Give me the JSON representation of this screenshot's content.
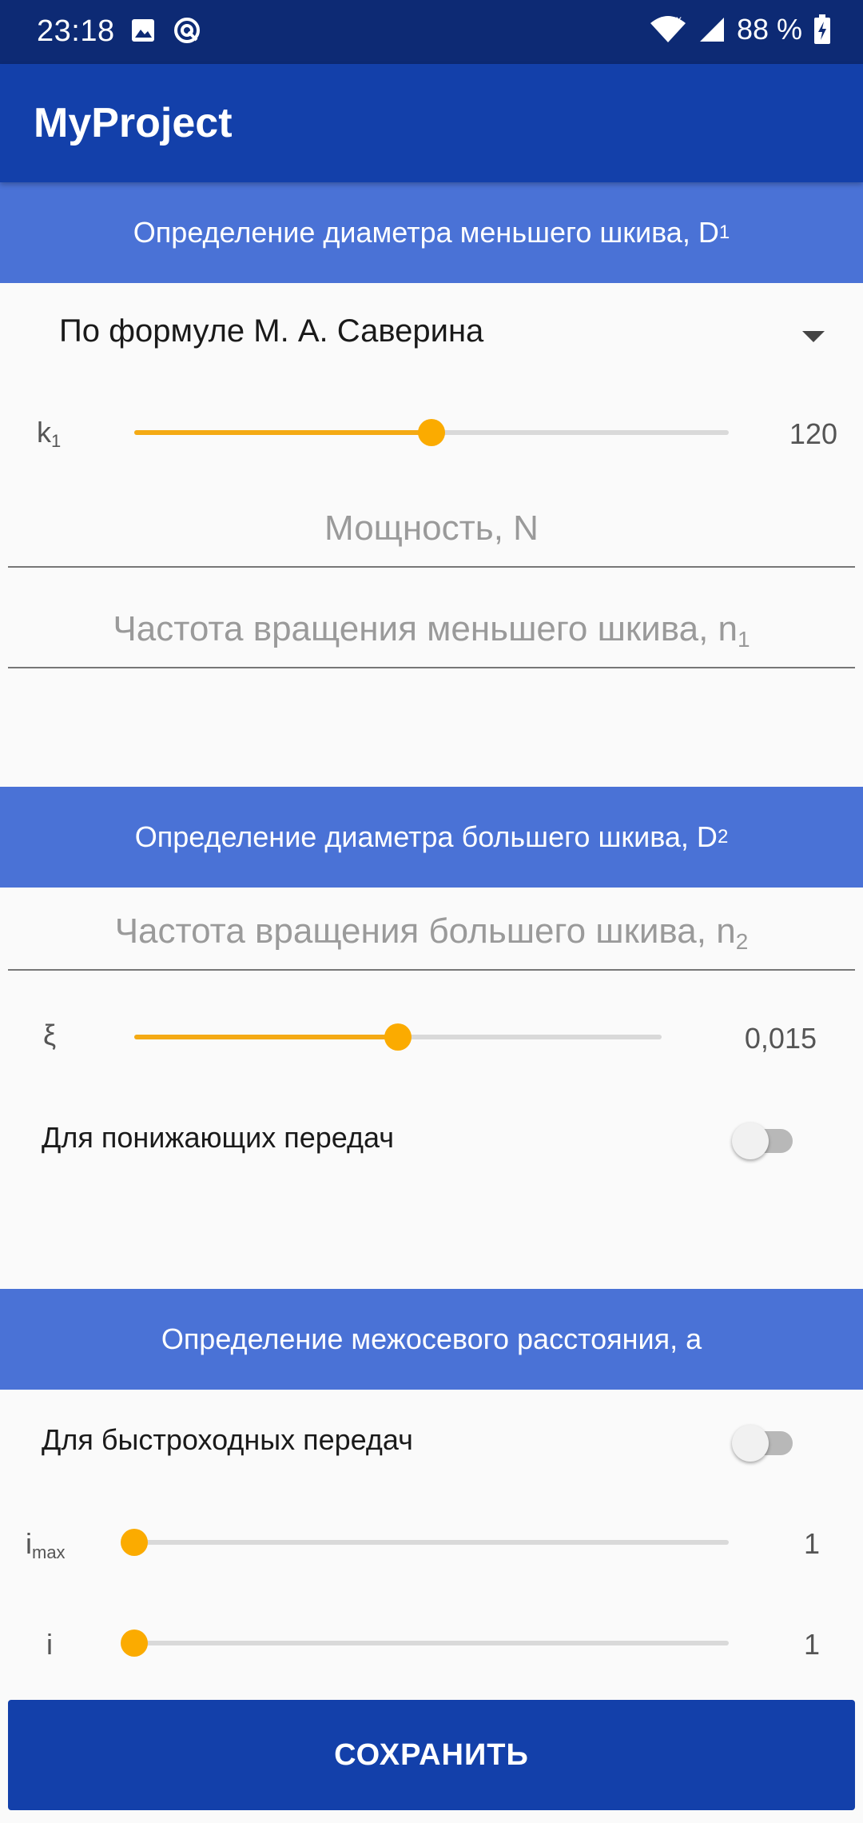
{
  "status_bar": {
    "time": "23:18",
    "battery": "88 %"
  },
  "app_bar": {
    "title": "MyProject"
  },
  "section1": {
    "header": "Определение диаметра меньшего шкива, D",
    "header_sub": "1",
    "method_dropdown": {
      "value": "По формуле М. А. Саверина"
    },
    "k1_slider": {
      "label": "k",
      "label_sub": "1",
      "value_text": "120",
      "level": 0.5
    },
    "power_input": {
      "placeholder": "Мощность, N"
    },
    "n1_input": {
      "placeholder": "Частота вращения меньшего шкива, n",
      "placeholder_sub": "1"
    }
  },
  "section2": {
    "header": "Определение диаметра большего шкива, D",
    "header_sub": "2",
    "n2_input": {
      "placeholder": "Частота вращения большего шкива, n",
      "placeholder_sub": "2"
    },
    "xi_slider": {
      "label": "ξ",
      "value_text": "0,015",
      "level": 0.5
    },
    "reduction_switch": {
      "label": "Для понижающих передач",
      "checked": false
    }
  },
  "section3": {
    "header": "Определение межосевого расстояния, a",
    "fast_switch": {
      "label": "Для быстроходных передач",
      "checked": false
    },
    "imax_slider": {
      "label": "i",
      "label_sub": "max",
      "value_text": "1",
      "level": 0
    },
    "i_slider": {
      "label": "i",
      "value_text": "1",
      "level": 0
    }
  },
  "save_button": {
    "label": "СОХРАНИТЬ"
  },
  "colors": {
    "status_bar": "#0d2a74",
    "app_bar": "#1340aa",
    "section_header": "#4a72d6",
    "accent": "#fbab00"
  }
}
